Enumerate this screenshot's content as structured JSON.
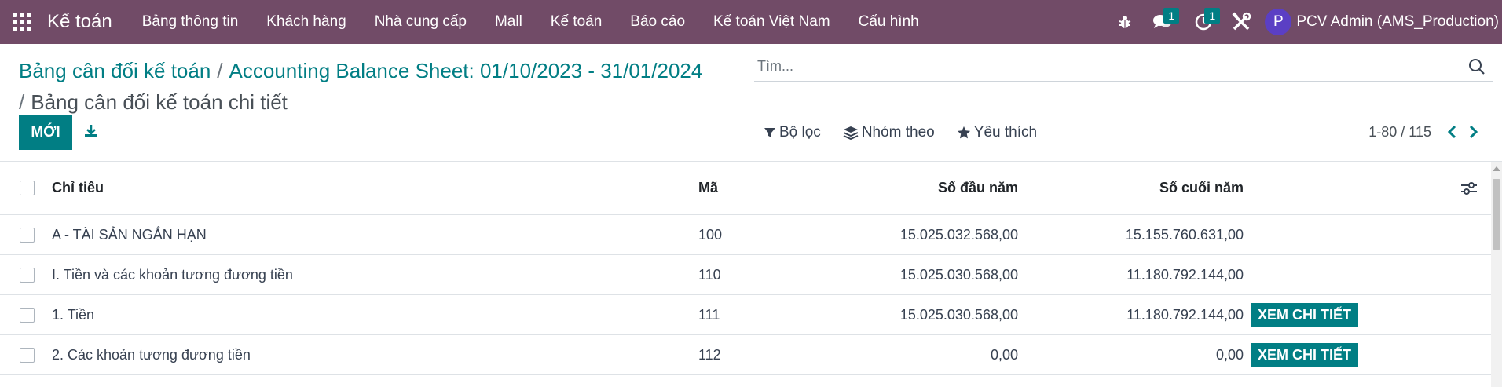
{
  "app": {
    "title": "Kế toán"
  },
  "menu": {
    "items": [
      {
        "label": "Bảng thông tin"
      },
      {
        "label": "Khách hàng"
      },
      {
        "label": "Nhà cung cấp"
      },
      {
        "label": "Mall"
      },
      {
        "label": "Kế toán"
      },
      {
        "label": "Báo cáo"
      },
      {
        "label": "Kế toán Việt Nam"
      },
      {
        "label": "Cấu hình"
      }
    ]
  },
  "systray": {
    "bug_icon": "bug-icon",
    "messages_count": "1",
    "activities_count": "1",
    "tools_icon": "tools-icon",
    "user": {
      "avatar_letter": "P",
      "name": "PCV Admin (AMS_Production)"
    }
  },
  "breadcrumb": {
    "items": [
      {
        "label": "Bảng cân đối kế toán"
      },
      {
        "label": "Accounting Balance Sheet: 01/10/2023 - 31/01/2024"
      }
    ],
    "current": "Bảng cân đối kế toán chi tiết",
    "separator": "/"
  },
  "toolbar": {
    "new_label": "MỚI",
    "download_icon": "download-icon"
  },
  "search": {
    "placeholder": "Tìm...",
    "value": ""
  },
  "filters": {
    "filter_label": "Bộ lọc",
    "group_label": "Nhóm theo",
    "favorite_label": "Yêu thích"
  },
  "pager": {
    "value": "1-80 / 115"
  },
  "table": {
    "columns": {
      "name": "Chỉ tiêu",
      "code": "Mã",
      "opening": "Số đầu năm",
      "closing": "Số cuối năm"
    },
    "rows": [
      {
        "name": "A - TÀI SẢN NGẮN HẠN",
        "code": "100",
        "opening": "15.025.032.568,00",
        "closing": "15.155.760.631,00",
        "action": ""
      },
      {
        "name": "I. Tiền và các khoản tương đương tiền",
        "code": "110",
        "opening": "15.025.030.568,00",
        "closing": "11.180.792.144,00",
        "action": ""
      },
      {
        "name": "1. Tiền",
        "code": "111",
        "opening": "15.025.030.568,00",
        "closing": "11.180.792.144,00",
        "action": "XEM CHI TIẾT"
      },
      {
        "name": "2. Các khoản tương đương tiền",
        "code": "112",
        "opening": "0,00",
        "closing": "0,00",
        "action": "XEM CHI TIẾT"
      }
    ]
  },
  "colors": {
    "navbar": "#714B67",
    "primary": "#017e84",
    "avatar": "#5b3fc4"
  }
}
